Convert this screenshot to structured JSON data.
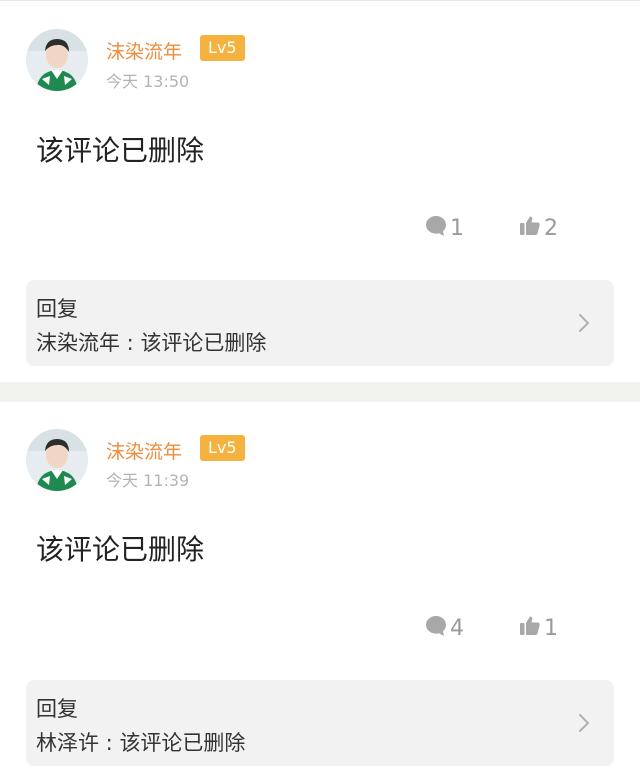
{
  "comments": [
    {
      "username": "沫染流年",
      "level": "Lv5",
      "time": "今天 13:50",
      "content": "该评论已删除",
      "comment_count": "1",
      "like_count": "2",
      "reply": {
        "title": "回复",
        "author": "沫染流年",
        "separator": " : ",
        "text": "该评论已删除"
      }
    },
    {
      "username": "沫染流年",
      "level": "Lv5",
      "time": "今天 11:39",
      "content": "该评论已删除",
      "comment_count": "4",
      "like_count": "1",
      "reply": {
        "title": "回复",
        "author": "林泽许",
        "separator": " : ",
        "text": "该评论已删除"
      }
    }
  ],
  "icons": {
    "comment": "comment-bubble-icon",
    "like": "thumbs-up-icon",
    "arrow": "chevron-right-icon"
  },
  "colors": {
    "username": "#ee8c3a",
    "level_badge": "#f5b23f",
    "time": "#b3b3b3",
    "reply_background": "#f2f2f2",
    "separator": "#f2f2ef",
    "icon": "#a8a8a8"
  }
}
